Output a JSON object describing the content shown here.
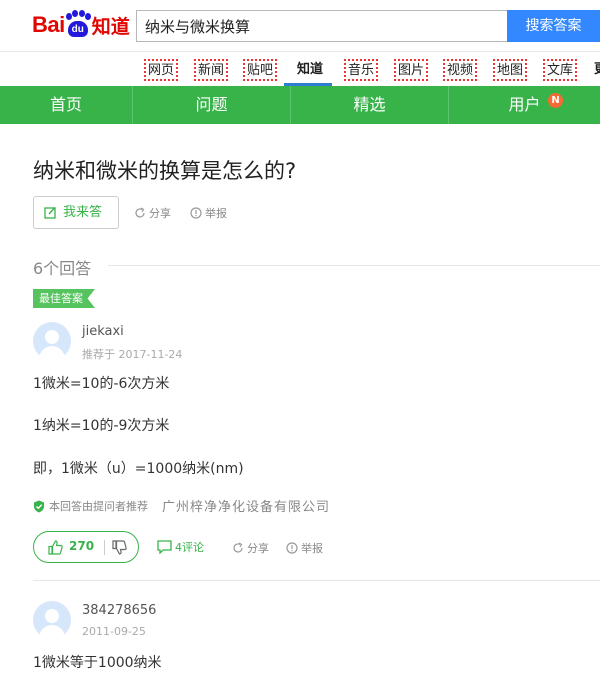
{
  "header": {
    "logo": {
      "bai": "Bai",
      "du": "du",
      "zhidao": "知道"
    },
    "search_value": "纳米与微米换算",
    "search_button": "搜索答案"
  },
  "nav": {
    "items": [
      "网页",
      "新闻",
      "贴吧",
      "知道",
      "音乐",
      "图片",
      "视频",
      "地图",
      "文库",
      "更"
    ],
    "active": "知道"
  },
  "menu": {
    "items": [
      "首页",
      "问题",
      "精选",
      "用户"
    ],
    "user_badge": "N"
  },
  "question": {
    "title": "纳米和微米的换算是怎么的?",
    "answer_button": "我来答",
    "share": "分享",
    "report": "举报"
  },
  "answers_count": "6个回答",
  "best_answer": {
    "tag": "最佳答案",
    "username": "jiekaxi",
    "date": "推荐于 2017-11-24",
    "lines": [
      "1微米=10的-6次方米",
      "1纳米=10的-9次方米",
      "即，1微米（u）=1000纳米(nm)"
    ],
    "recommend": "本回答由提问者推荐",
    "company": "广州梓净净化设备有限公司",
    "likes": "270",
    "comments": "4评论",
    "share": "分享",
    "report": "举报"
  },
  "second_answer": {
    "username": "384278656",
    "date": "2011-09-25",
    "line": "1微米等于1000纳米"
  },
  "colors": {
    "brand_red": "#e10602",
    "brand_blue": "#2319dc",
    "search_blue": "#3388ff",
    "menu_green": "#38b34a",
    "badge_orange": "#f86a33"
  }
}
